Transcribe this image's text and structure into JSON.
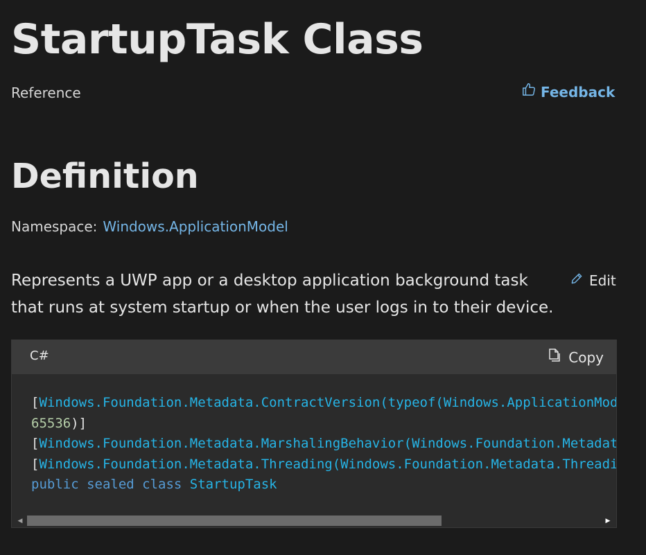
{
  "page": {
    "title": "StartupTask Class",
    "reference_label": "Reference",
    "feedback_label": "Feedback",
    "section_title": "Definition",
    "namespace_label": "Namespace:",
    "namespace_link": "Windows.ApplicationModel",
    "summary": "Represents a UWP app or a desktop application background task that runs at system startup or when the user logs in to their device.",
    "edit_label": "Edit"
  },
  "code": {
    "language": "C#",
    "copy_label": "Copy",
    "line1_open": "[",
    "line1_type": "Windows.Foundation.Metadata.ContractVersion(typeof(Windows.ApplicationModel.StartupTaskContract),",
    "line2_num": "65536",
    "line2_close": ")]",
    "line3_open": "[",
    "line3_type": "Windows.Foundation.Metadata.MarshalingBehavior(Windows.Foundation.Metadata.MarshalingType.Agile)]",
    "line4_open": "[",
    "line4_type": "Windows.Foundation.Metadata.Threading(Windows.Foundation.Metadata.ThreadingModel.Both)]",
    "line5_kw": "public sealed class",
    "line5_type": "StartupTask"
  },
  "icons": {
    "feedback": "thumbs-up-icon",
    "edit": "pencil-icon",
    "copy": "copy-icon"
  },
  "colors": {
    "background": "#1b1b1b",
    "link": "#75b6e7",
    "code_type": "#26b4e6",
    "code_keyword": "#569cd6",
    "code_number": "#b5cea8"
  }
}
